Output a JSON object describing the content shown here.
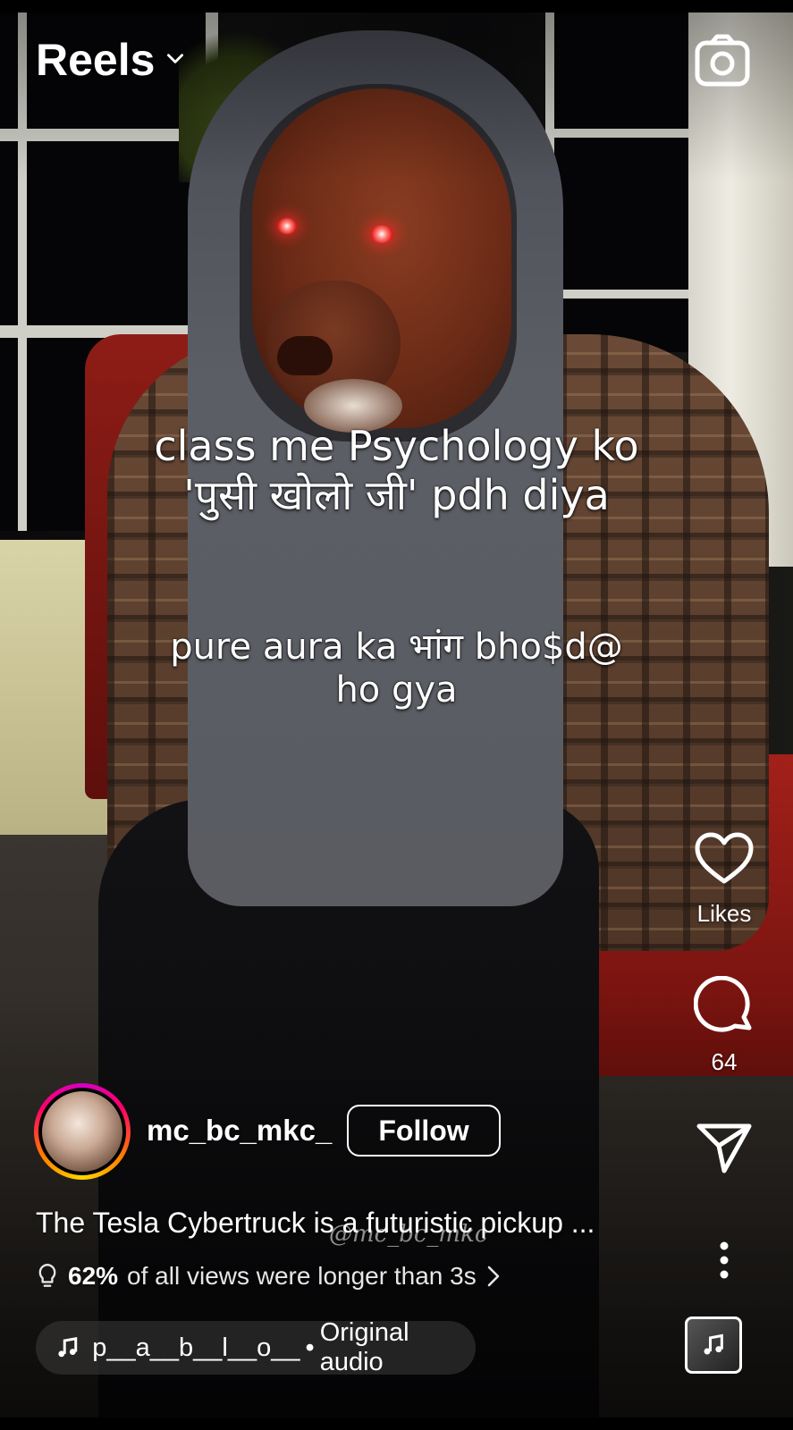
{
  "header": {
    "title": "Reels",
    "title_dropdown_icon": "chevron-down-icon",
    "camera_icon": "camera-icon"
  },
  "overlay": {
    "caption_1_lines": [
      "class me Psychology ko",
      "'पुसी खोलो जी' pdh diya"
    ],
    "caption_2_lines": [
      "pure aura ka भांग bho$d@",
      "ho gya"
    ]
  },
  "actions": {
    "like_label": "Likes",
    "like_icon": "heart-icon",
    "comment_count": "64",
    "comment_icon": "comment-icon",
    "share_icon": "send-icon",
    "more_icon": "more-vertical-icon",
    "audio_thumb_icon": "music-note-icon"
  },
  "author": {
    "username": "mc_bc_mkc_",
    "follow_label": "Follow"
  },
  "post": {
    "description": "The Tesla Cybertruck is a futuristic pickup ...",
    "watermark": "@mc_bc_mkc"
  },
  "insight": {
    "percent": "62%",
    "text": "of all views were longer than 3s",
    "icon": "lightbulb-icon",
    "chevron_icon": "chevron-right-icon"
  },
  "audio": {
    "artist": "p__a__b__l__o__",
    "separator": "•",
    "label": "Original audio",
    "icon": "music-note-icon"
  },
  "colors": {
    "text": "#ffffff",
    "story_ring": [
      "#d300c5",
      "#ff0069",
      "#ff7a00",
      "#ffd600"
    ]
  }
}
